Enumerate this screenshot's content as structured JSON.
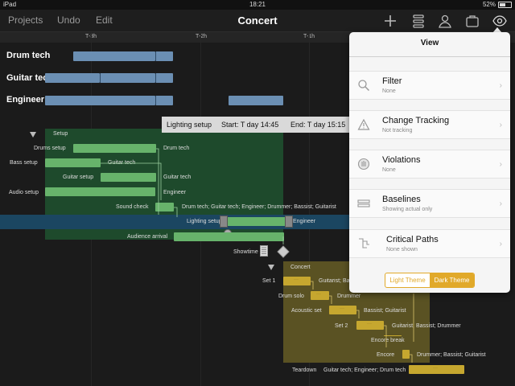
{
  "status": {
    "device": "iPad",
    "time": "18:21",
    "battery": "52%"
  },
  "toolbar": {
    "projects": "Projects",
    "undo": "Undo",
    "edit": "Edit",
    "title": "Concert"
  },
  "timescale": [
    "T-3h",
    "T-2h",
    "T-1h"
  ],
  "resources": [
    "Drum tech",
    "Guitar tech",
    "Engineer"
  ],
  "tooltip": {
    "name": "Lighting setup",
    "start": "Start: T day 14:45",
    "end": "End: T day 15:15"
  },
  "tasks": {
    "setup": "Setup",
    "drums_setup": "Drums setup",
    "drums_setup_res": "Drum tech",
    "bass_setup": "Bass setup",
    "bass_setup_res": "Guitar tech",
    "guitar_setup": "Guitar setup",
    "guitar_setup_res": "Guitar tech",
    "audio_setup": "Audio setup",
    "audio_setup_res": "Engineer",
    "sound_check": "Sound check",
    "sound_check_res": "Drum tech; Guitar tech; Engineer; Drummer; Bassist; Guitarist",
    "lighting_setup": "Lighting setup",
    "lighting_setup_res": "Engineer",
    "audience_arrival": "Audience arrival",
    "showtime": "Showtime",
    "concert": "Concert",
    "set1": "Set 1",
    "set1_res": "Guitarist; Bassist; Drummer",
    "drum_solo": "Drum solo",
    "drum_solo_res": "Drummer",
    "acoustic_set": "Acoustic set",
    "acoustic_set_res": "Bassist; Guitarist",
    "set2": "Set 2",
    "set2_res": "Guitarist; Bassist; Drummer",
    "encore_break": "Encore break",
    "encore": "Encore",
    "encore_res": "Drummer; Bassist; Guitarist",
    "teardown": "Teardown",
    "teardown_res": "Guitar tech; Engineer; Drum tech"
  },
  "view_menu": {
    "title": "View",
    "items": [
      {
        "title": "Filter",
        "sub": "None",
        "icon": "magnifier-icon"
      },
      {
        "title": "Change Tracking",
        "sub": "Not tracking",
        "icon": "warning-triangle-icon"
      },
      {
        "title": "Violations",
        "sub": "None",
        "icon": "violations-icon"
      },
      {
        "title": "Baselines",
        "sub": "Showing actual only",
        "icon": "baselines-icon"
      },
      {
        "title": "Critical Paths",
        "sub": "None shown",
        "icon": "critical-path-icon"
      }
    ],
    "light_theme": "Light Theme",
    "dark_theme": "Dark Theme"
  },
  "colors": {
    "accent": "#e1a92a",
    "setup_bar": "#67b36b",
    "concert_bar": "#c6a72f",
    "resource_bar": "#6b8fb3"
  }
}
